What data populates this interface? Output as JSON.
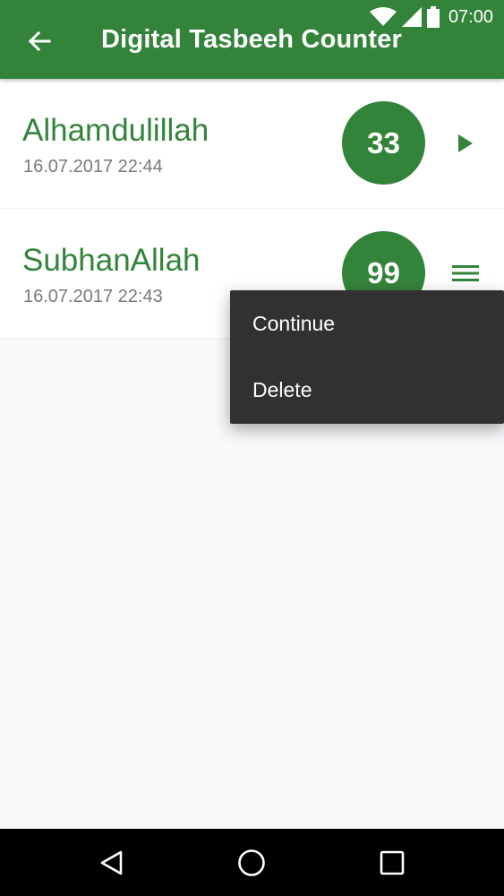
{
  "status_bar": {
    "time": "07:00",
    "icons": [
      "wifi-icon",
      "cell-signal-icon",
      "battery-icon"
    ]
  },
  "appbar": {
    "title": "Digital Tasbeeh Counter",
    "back_icon": "arrow-left-icon"
  },
  "items": [
    {
      "name": "Alhamdulillah",
      "date": "16.07.2017 22:44",
      "count": "33",
      "action_icon": "play-icon"
    },
    {
      "name": "SubhanAllah",
      "date": "16.07.2017 22:43",
      "count": "99",
      "action_icon": "menu-icon"
    }
  ],
  "context_menu": {
    "items": [
      {
        "label": "Continue"
      },
      {
        "label": "Delete"
      }
    ]
  },
  "nav_bar": {
    "icons": [
      "back-triangle-icon",
      "home-circle-icon",
      "recents-square-icon"
    ]
  },
  "colors": {
    "primary": "#33843a",
    "menu_bg": "#323033",
    "background": "#f9f8fb",
    "date_text": "#7a7a7a"
  }
}
